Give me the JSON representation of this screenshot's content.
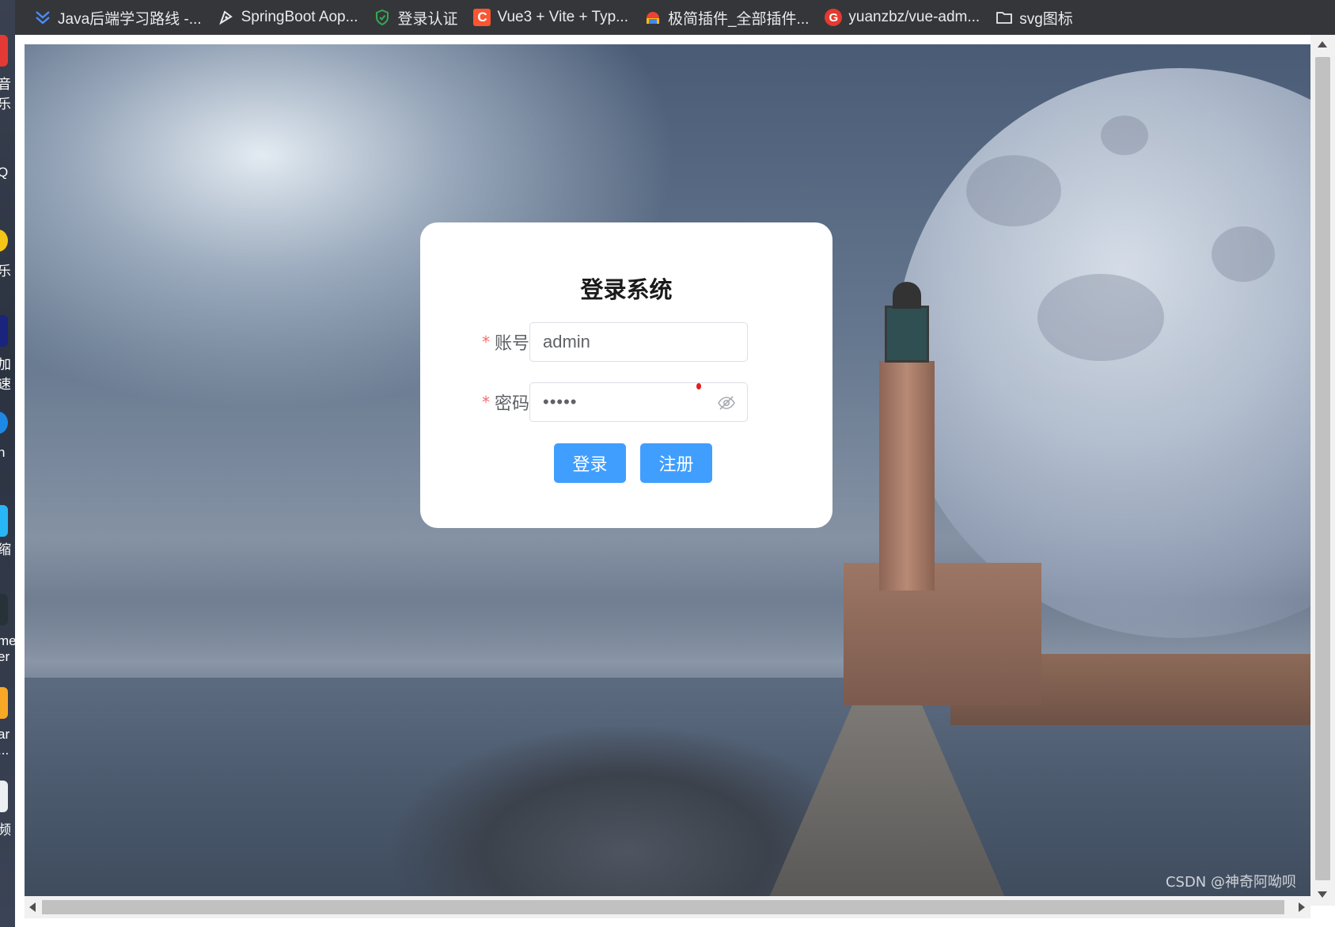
{
  "bookmarks": [
    {
      "label": "Java后端学习路线 -...",
      "icon": "double-chevron-icon",
      "color": "#4a8cf7"
    },
    {
      "label": "SpringBoot Aop...",
      "icon": "pen-nib-icon",
      "color": "#e8eaed"
    },
    {
      "label": "登录认证",
      "icon": "shield-icon",
      "color": "#34a853"
    },
    {
      "label": "Vue3 + Vite + Typ...",
      "icon": "csdn-c-icon",
      "color": "#fc5531"
    },
    {
      "label": "极简插件_全部插件...",
      "icon": "chrome-puzzle-icon",
      "color": "#ea4335"
    },
    {
      "label": "yuanzbz/vue-adm...",
      "icon": "gitee-g-icon",
      "color": "#e63a2e"
    },
    {
      "label": "svg图标",
      "icon": "folder-icon",
      "color": "#e8eaed"
    }
  ],
  "login": {
    "title": "登录系统",
    "account_label": "账号",
    "account_value": "admin",
    "password_label": "密码",
    "password_value": "•••••",
    "required_mark": "*",
    "login_button": "登录",
    "register_button": "注册"
  },
  "desktop_labels": [
    "音乐",
    "Q",
    "乐",
    "加速",
    "n",
    "缩",
    "me er",
    "ar ...",
    "频"
  ],
  "colors": {
    "primary": "#409eff",
    "required": "#f56c6c",
    "card": "#ffffff",
    "tabbar": "#35363a"
  },
  "watermark": "CSDN @神奇阿呦呗"
}
